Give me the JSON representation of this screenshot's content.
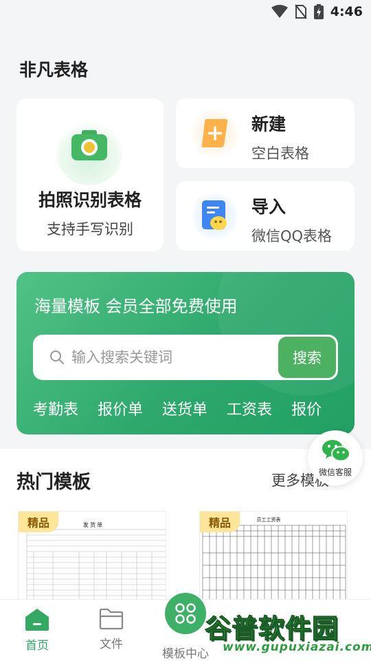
{
  "status": {
    "time": "4:46"
  },
  "app": {
    "title": "非凡表格"
  },
  "cards": {
    "photo": {
      "title": "拍照识别表格",
      "subtitle": "支持手写识别"
    },
    "new": {
      "title": "新建",
      "subtitle": "空白表格"
    },
    "import": {
      "title": "导入",
      "subtitle": "微信QQ表格"
    }
  },
  "banner": {
    "title": "海量模板 会员全部免费使用",
    "search_placeholder": "输入搜索关键词",
    "search_button": "搜索",
    "tags": [
      "考勤表",
      "报价单",
      "送货单",
      "工资表",
      "报价"
    ]
  },
  "hot": {
    "title": "热门模板",
    "more": "更多模板",
    "badge": "精品",
    "thumb1_title": "发 货 单",
    "thumb2_title": "员工工资表"
  },
  "fab": {
    "label": "微信客服"
  },
  "nav": {
    "home": "首页",
    "file": "文件",
    "templates": "模板中心"
  },
  "watermark": {
    "brand": "谷普软件园",
    "url": "www.gupuxiazai.com"
  },
  "colors": {
    "primary": "#2fa66a",
    "banner": "#3db878",
    "badge": "#fde59a"
  }
}
